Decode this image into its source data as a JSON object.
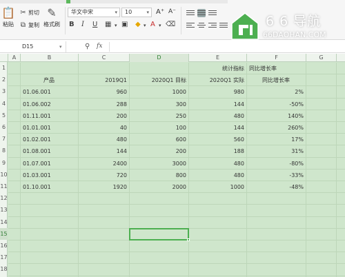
{
  "toolbar": {
    "paste_label": "粘贴",
    "cut_label": "剪切",
    "copy_label": "复制",
    "format_painter_label": "格式刷",
    "font_name": "华文中宋",
    "font_size": "10",
    "grow_font_glyph": "A⁺",
    "shrink_font_glyph": "A⁻",
    "bold_glyph": "B",
    "italic_glyph": "I",
    "underline_glyph": "U",
    "accent_color": "#5cb85c"
  },
  "watermark": {
    "title": "6 6 导航",
    "domain": "66DAOHAN.COM"
  },
  "formula_bar": {
    "name_box": "D15",
    "zoom_icon": "search-icon",
    "fx_label": "fx",
    "formula": ""
  },
  "sheet": {
    "columns": [
      "A",
      "B",
      "C",
      "D",
      "E",
      "F",
      "G"
    ],
    "selected_column": "D",
    "rows": [
      "1",
      "2",
      "3",
      "4",
      "5",
      "6",
      "7",
      "8",
      "9",
      "10",
      "11",
      "12",
      "13",
      "14",
      "15",
      "16",
      "17",
      "18"
    ],
    "selected_row": "15",
    "header_row1": {
      "e": "统计指标",
      "f": "同比增长率"
    },
    "header_row2": {
      "b": "产品",
      "c": "2019Q1",
      "d": "2020Q1 目标",
      "e": "2020Q1 实际",
      "f": "同比增长率"
    },
    "data_rows": [
      {
        "product": "01.06.001",
        "q1_2019": "960",
        "target_2020": "1000",
        "actual_2020": "980",
        "growth": "2%"
      },
      {
        "product": "01.06.002",
        "q1_2019": "288",
        "target_2020": "300",
        "actual_2020": "144",
        "growth": "-50%"
      },
      {
        "product": "01.11.001",
        "q1_2019": "200",
        "target_2020": "250",
        "actual_2020": "480",
        "growth": "140%"
      },
      {
        "product": "01.01.001",
        "q1_2019": "40",
        "target_2020": "100",
        "actual_2020": "144",
        "growth": "260%"
      },
      {
        "product": "01.02.001",
        "q1_2019": "480",
        "target_2020": "600",
        "actual_2020": "560",
        "growth": "17%"
      },
      {
        "product": "01.08.001",
        "q1_2019": "144",
        "target_2020": "200",
        "actual_2020": "188",
        "growth": "31%"
      },
      {
        "product": "01.07.001",
        "q1_2019": "2400",
        "target_2020": "3000",
        "actual_2020": "480",
        "growth": "-80%"
      },
      {
        "product": "01.03.001",
        "q1_2019": "720",
        "target_2020": "800",
        "actual_2020": "480",
        "growth": "-33%"
      },
      {
        "product": "01.10.001",
        "q1_2019": "1920",
        "target_2020": "2000",
        "actual_2020": "1000",
        "growth": "-48%"
      }
    ],
    "grid_color": "#bdd6b9",
    "background_color": "#cfe6cc",
    "selection_color": "#4caf50"
  }
}
